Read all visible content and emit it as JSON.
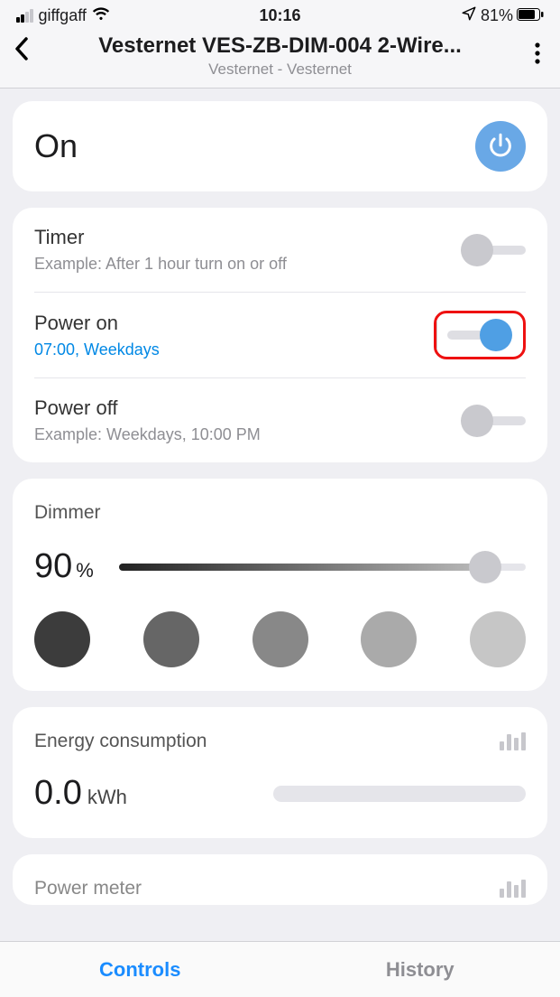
{
  "status": {
    "carrier": "giffgaff",
    "time": "10:16",
    "battery": "81%"
  },
  "header": {
    "title": "Vesternet VES-ZB-DIM-004 2-Wire...",
    "subtitle": "Vesternet - Vesternet"
  },
  "state": {
    "label": "On"
  },
  "schedule": {
    "timer": {
      "title": "Timer",
      "sub": "Example: After 1 hour turn on or off",
      "on": false
    },
    "power_on": {
      "title": "Power on",
      "sub": "07:00, Weekdays",
      "on": true
    },
    "power_off": {
      "title": "Power off",
      "sub": "Example: Weekdays, 10:00 PM",
      "on": false
    }
  },
  "dimmer": {
    "title": "Dimmer",
    "value": "90",
    "unit": "%",
    "shades": [
      "#3c3c3c",
      "#666666",
      "#888888",
      "#aaaaaa",
      "#c6c6c6"
    ]
  },
  "energy": {
    "title": "Energy consumption",
    "value": "0.0",
    "unit": "kWh"
  },
  "meter": {
    "title": "Power meter"
  },
  "tabs": {
    "controls": "Controls",
    "history": "History"
  }
}
